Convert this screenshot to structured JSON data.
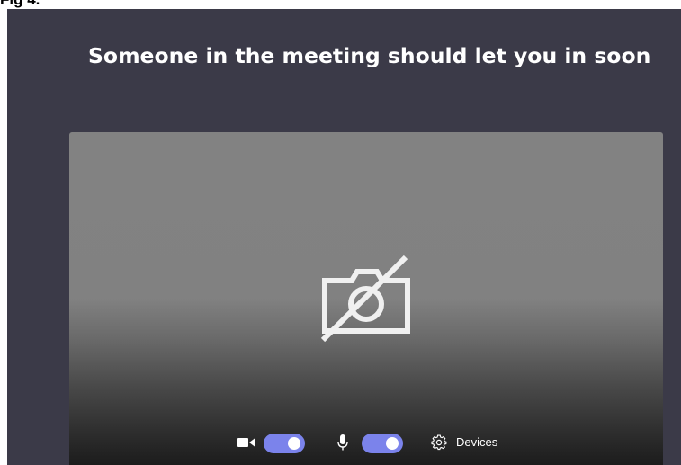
{
  "figure": {
    "label": "Fig 4."
  },
  "lobby": {
    "title": "Someone in the meeting should let you in soon"
  },
  "preview": {
    "camera_icon": "camera-off-icon"
  },
  "controls": {
    "video": {
      "icon": "video-camera-icon",
      "toggle_on": true
    },
    "mic": {
      "icon": "microphone-icon",
      "toggle_on": true
    },
    "devices": {
      "icon": "gear-icon",
      "label": "Devices"
    }
  },
  "colors": {
    "background": "#3b3a48",
    "toggle_accent": "#7b83eb",
    "title_text": "#ffffff"
  }
}
